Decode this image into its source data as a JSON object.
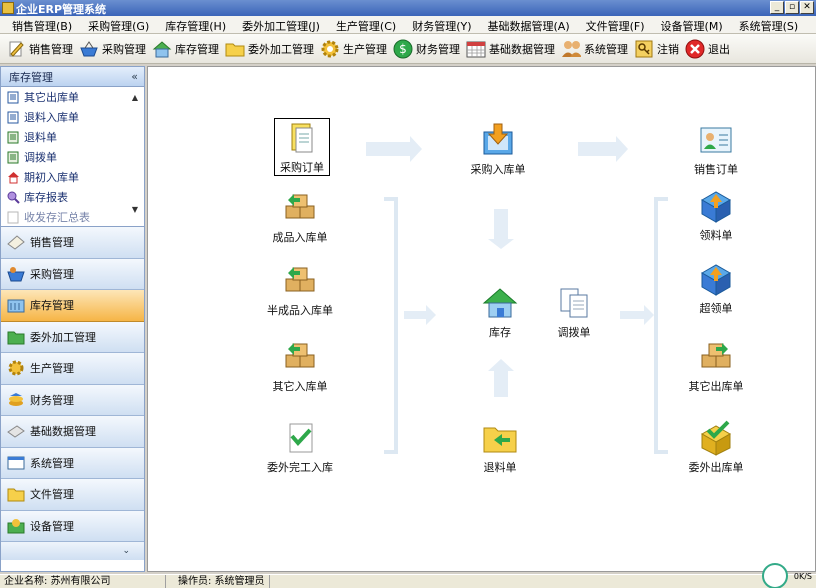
{
  "window": {
    "title": "企业ERP管理系统",
    "buttons": [
      "_",
      "▫",
      "✕"
    ]
  },
  "menu": [
    "销售管理(B)",
    "采购管理(G)",
    "库存管理(H)",
    "委外加工管理(J)",
    "生产管理(C)",
    "财务管理(Y)",
    "基础数据管理(A)",
    "文件管理(F)",
    "设备管理(M)",
    "系统管理(S)"
  ],
  "toolbar": [
    {
      "label": "销售管理",
      "icon": "pencil-paper-icon"
    },
    {
      "label": "采购管理",
      "icon": "basket-icon"
    },
    {
      "label": "库存管理",
      "icon": "house-icon"
    },
    {
      "label": "委外加工管理",
      "icon": "folder-icon"
    },
    {
      "label": "生产管理",
      "icon": "gear-icon"
    },
    {
      "label": "财务管理",
      "icon": "dollar-icon"
    },
    {
      "label": "基础数据管理",
      "icon": "calendar-grid-icon"
    },
    {
      "label": "系统管理",
      "icon": "people-icon"
    },
    {
      "label": "注销",
      "icon": "key-icon"
    },
    {
      "label": "退出",
      "icon": "exit-icon"
    }
  ],
  "sidebar": {
    "header": "库存管理",
    "collapse": "«",
    "sub_items": [
      "其它出库单",
      "退料入库单",
      "退料单",
      "调拨单",
      "期初入库单",
      "库存报表",
      "收发存汇总表"
    ],
    "groups": [
      "销售管理",
      "采购管理",
      "库存管理",
      "委外加工管理",
      "生产管理",
      "财务管理",
      "基础数据管理",
      "系统管理",
      "文件管理",
      "设备管理"
    ],
    "active_group": "库存管理",
    "footer": "⌄"
  },
  "flow": {
    "left": [
      "采购订单",
      "成品入库单",
      "半成品入库单",
      "其它入库单",
      "委外完工入库"
    ],
    "center": [
      "采购入库单",
      "库存",
      "调拨单",
      "退料单"
    ],
    "right": [
      "销售订单",
      "领料单",
      "超领单",
      "其它出库单",
      "委外出库单"
    ]
  },
  "status": {
    "company": "企业名称: 苏州有限公司",
    "operator": "操作员: 系统管理员",
    "speed": "0K/S",
    "gauge": "49%"
  },
  "colors": {
    "accent": "#f6b546",
    "panel": "#cfdff2",
    "arrow": "#dfe9f3"
  }
}
